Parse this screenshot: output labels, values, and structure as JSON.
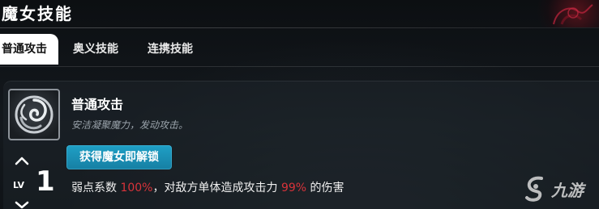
{
  "header": {
    "title": "魔女技能"
  },
  "tabs": [
    {
      "label": "普通攻击",
      "active": true
    },
    {
      "label": "奥义技能",
      "active": false
    },
    {
      "label": "连携技能",
      "active": false
    }
  ],
  "skill": {
    "icon": "swirl-emblem-icon",
    "name": "普通攻击",
    "description": "安洁凝聚魔力，发动攻击。",
    "unlock_button": "获得魔女即解锁",
    "level_label": "LV",
    "level_value": "1",
    "effect": {
      "prefix": "弱点系数 ",
      "weakness_value": "100%",
      "middle": "，对敌方单体造成攻击力 ",
      "attack_value": "99%",
      "suffix": " 的伤害"
    }
  },
  "watermark": {
    "text": "九游",
    "icon": "jiuyou-logo-icon"
  },
  "colors": {
    "accent": "#1a8fb8",
    "highlight_red": "#d8333a",
    "tab_active_bg": "#ffffff"
  }
}
